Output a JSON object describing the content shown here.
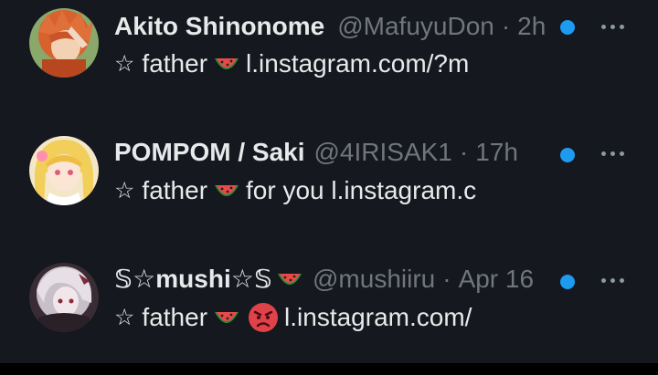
{
  "conversations": [
    {
      "name": "Akito Shinonome",
      "handle": "@MafuyuDon",
      "separator": "·",
      "time": "2h",
      "preview_star": "☆",
      "preview_word": "father",
      "preview_emoji": "watermelon-icon",
      "preview_text": "l.instagram.com/?m",
      "unread": true,
      "avatar": "avatar-orange-hair"
    },
    {
      "name": "POMPOM / Saki",
      "handle": "@4IRISAK1",
      "separator": "·",
      "time": "17h",
      "preview_star": "☆",
      "preview_word": "father",
      "preview_emoji": "watermelon-icon",
      "preview_text": "for you l.instagram.c",
      "unread": true,
      "avatar": "avatar-blonde-hair"
    },
    {
      "name": "𝕊☆mushi☆𝕊",
      "name_emoji": "watermelon-icon",
      "handle": "@mushiiru",
      "separator": "·",
      "time": "Apr 16",
      "preview_star": "☆",
      "preview_word": "father",
      "preview_emoji": "watermelon-icon",
      "preview_emoji_2": "angry-face-icon",
      "preview_text": "l.instagram.com/",
      "unread": true,
      "avatar": "avatar-dark-anime"
    }
  ],
  "colors": {
    "background": "#15181e",
    "primary_text": "#e7e9ea",
    "secondary_text": "#71767b",
    "unread_dot": "#1d9bf0"
  }
}
